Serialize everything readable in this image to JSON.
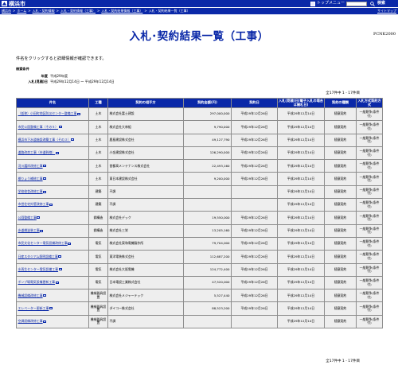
{
  "header": {
    "site_name": "横浜市",
    "menu_label": "トップメニュー",
    "search_label": "検索"
  },
  "breadcrumb": {
    "items": [
      "横浜市",
      "ホーム",
      "入札・契約情報",
      "入札・契約情報（工事）",
      "入札・契約結果情報（工事）",
      "入札・契約結果一覧（工事）"
    ],
    "separator": ">",
    "sitemap": "サイトマップ"
  },
  "page": {
    "title": "入札･契約結果一覧（工事）",
    "code": "PCNK2000",
    "note": "件名をクリックすると詳細情報が確認できます。"
  },
  "conditions": {
    "heading": "検索条件",
    "fiscal_year_label": "年度",
    "fiscal_year_value": "平成29年度",
    "bid_date_label": "入札(見積)日",
    "bid_date_value": "平成29年12月14日 〜 平成29年12月14日"
  },
  "count_text": "全17件中 1 - 17件目",
  "table": {
    "headers": [
      "件名",
      "工種",
      "契約の相手方",
      "契約金額(円)",
      "契約日",
      "入札(見積)日(電子入札の場合は開札日)",
      "契約の種類",
      "入札方式契約方式"
    ],
    "rows": [
      [
        "（仮称）小田町地区防災センター整備工事",
        "土木",
        "株式会社富士建設",
        "297,000,000",
        "平成29年12月26日",
        "平成29年12月14日",
        "随意契約",
        "一般競争(条件付)"
      ],
      [
        "市民公園整備工事（その５）",
        "土木",
        "株式会社大林組",
        "9,790,000",
        "平成29年12月26日",
        "平成29年12月14日",
        "随意契約",
        "一般競争(条件付)"
      ],
      [
        "横浜市下水道施設改築工事（その３）",
        "土木",
        "鹿島建設株式会社",
        "49,127,790",
        "平成29年12月26日",
        "平成29年12月14日",
        "随意契約",
        "一般競争(条件付)"
      ],
      [
        "道路改良工事（市道幹線）",
        "土木",
        "小金建設株式会社",
        "126,290,000",
        "平成29年12月26日",
        "平成29年12月14日",
        "随意契約",
        "一般競争(条件付)"
      ],
      [
        "河川護岸改修工事",
        "土木",
        "首都高メンテナンス株式会社",
        "22,493,160",
        "平成29年12月26日",
        "平成29年12月14日",
        "随意契約",
        "一般競争(条件付)"
      ],
      [
        "橋りょう補修工事",
        "土木",
        "東日本建設株式会社",
        "9,200,000",
        "平成29年12月26日",
        "平成29年12月14日",
        "随意契約",
        "一般競争(条件付)"
      ],
      [
        "学校校舎改修工事",
        "建築",
        "不調",
        "",
        "",
        "平成29年12月14日",
        "随意契約",
        "一般競争(条件付)"
      ],
      [
        "市営住宅外壁改修工事",
        "建築",
        "不調",
        "",
        "",
        "平成29年12月14日",
        "随意契約",
        "一般競争(条件付)"
      ],
      [
        "公園整備工事",
        "鋼構造",
        "株式会社デック",
        "19,550,000",
        "平成29年12月26日",
        "平成29年12月14日",
        "随意契約",
        "一般競争(条件付)"
      ],
      [
        "歩道橋塗装工事",
        "鋼構造",
        "株式会社三栄",
        "13,205,160",
        "平成29年12月26日",
        "平成29年12月14日",
        "随意契約",
        "一般競争(条件付)"
      ],
      [
        "市民文化センター電気設備改修工事",
        "電気",
        "株式会社東和電機製作所",
        "79,704,000",
        "平成29年12月26日",
        "平成29年12月14日",
        "随意契約",
        "一般競争(条件付)"
      ],
      [
        "日産スタジアム照明設備工事",
        "電気",
        "東洋電装株式会社",
        "112,687,200",
        "平成29年12月26日",
        "平成29年12月14日",
        "随意契約",
        "一般競争(条件付)"
      ],
      [
        "水再生センター電気設備工事",
        "電気",
        "株式会社大阪電機",
        "124,772,400",
        "平成29年12月26日",
        "平成29年12月14日",
        "随意契約",
        "一般競争(条件付)"
      ],
      [
        "ポンプ場電気設備更新工事",
        "電気",
        "日本電設工業株式会社",
        "47,520,000",
        "平成29年12月26日",
        "平成29年12月14日",
        "随意契約",
        "一般競争(条件付)"
      ],
      [
        "機械設備改修工事",
        "機械器具設置",
        "株式会社メジャーテック",
        "5,527,440",
        "平成29年12月26日",
        "平成29年12月14日",
        "随意契約",
        "一般競争(条件付)"
      ],
      [
        "エレベーター更新工事",
        "機械器具設置",
        "ダイコー株式会社",
        "88,523,200",
        "平成29年12月26日",
        "平成29年12月14日",
        "随意契約",
        "一般競争(条件付)"
      ],
      [
        "空調設備改修工事",
        "機械器具設置",
        "不調",
        "",
        "",
        "平成29年12月14日",
        "随意契約",
        "一般競争(条件付)"
      ]
    ]
  }
}
